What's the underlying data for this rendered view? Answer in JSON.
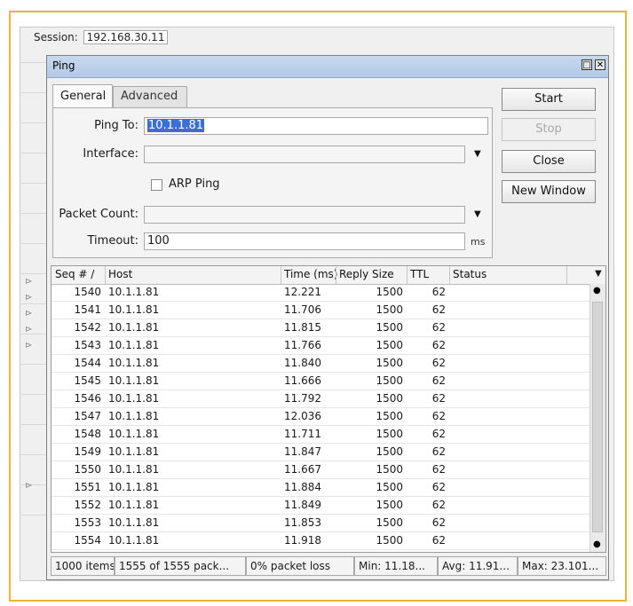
{
  "session": {
    "label": "Session:",
    "value": "192.168.30.11"
  },
  "window": {
    "title": "Ping"
  },
  "tabs": [
    {
      "label": "General"
    },
    {
      "label": "Advanced"
    }
  ],
  "form": {
    "ping_to_label": "Ping To:",
    "ping_to_value": "10.1.1.81",
    "interface_label": "Interface:",
    "interface_value": "",
    "arp_ping_label": "ARP Ping",
    "arp_ping_checked": false,
    "packet_count_label": "Packet Count:",
    "packet_count_value": "",
    "timeout_label": "Timeout:",
    "timeout_value": "100",
    "timeout_unit": "ms"
  },
  "buttons": {
    "start": "Start",
    "stop": "Stop",
    "close": "Close",
    "new_window": "New Window"
  },
  "table": {
    "columns": [
      "Seq # /",
      "Host",
      "Time (ms)",
      "Reply Size",
      "TTL",
      "Status"
    ],
    "rows": [
      {
        "seq": "1540",
        "host": "10.1.1.81",
        "time": "12.221",
        "size": "1500",
        "ttl": "62",
        "status": ""
      },
      {
        "seq": "1541",
        "host": "10.1.1.81",
        "time": "11.706",
        "size": "1500",
        "ttl": "62",
        "status": ""
      },
      {
        "seq": "1542",
        "host": "10.1.1.81",
        "time": "11.815",
        "size": "1500",
        "ttl": "62",
        "status": ""
      },
      {
        "seq": "1543",
        "host": "10.1.1.81",
        "time": "11.766",
        "size": "1500",
        "ttl": "62",
        "status": ""
      },
      {
        "seq": "1544",
        "host": "10.1.1.81",
        "time": "11.840",
        "size": "1500",
        "ttl": "62",
        "status": ""
      },
      {
        "seq": "1545",
        "host": "10.1.1.81",
        "time": "11.666",
        "size": "1500",
        "ttl": "62",
        "status": ""
      },
      {
        "seq": "1546",
        "host": "10.1.1.81",
        "time": "11.792",
        "size": "1500",
        "ttl": "62",
        "status": ""
      },
      {
        "seq": "1547",
        "host": "10.1.1.81",
        "time": "12.036",
        "size": "1500",
        "ttl": "62",
        "status": ""
      },
      {
        "seq": "1548",
        "host": "10.1.1.81",
        "time": "11.711",
        "size": "1500",
        "ttl": "62",
        "status": ""
      },
      {
        "seq": "1549",
        "host": "10.1.1.81",
        "time": "11.847",
        "size": "1500",
        "ttl": "62",
        "status": ""
      },
      {
        "seq": "1550",
        "host": "10.1.1.81",
        "time": "11.667",
        "size": "1500",
        "ttl": "62",
        "status": ""
      },
      {
        "seq": "1551",
        "host": "10.1.1.81",
        "time": "11.884",
        "size": "1500",
        "ttl": "62",
        "status": ""
      },
      {
        "seq": "1552",
        "host": "10.1.1.81",
        "time": "11.849",
        "size": "1500",
        "ttl": "62",
        "status": ""
      },
      {
        "seq": "1553",
        "host": "10.1.1.81",
        "time": "11.853",
        "size": "1500",
        "ttl": "62",
        "status": ""
      },
      {
        "seq": "1554",
        "host": "10.1.1.81",
        "time": "11.918",
        "size": "1500",
        "ttl": "62",
        "status": ""
      }
    ]
  },
  "statusbar": {
    "items": "1000 items",
    "packets": "1555 of 1555 pack...",
    "loss": "0% packet loss",
    "min": "Min: 11.18...",
    "avg": "Avg: 11.91...",
    "max": "Max: 23.101..."
  },
  "colors": {
    "frame": "#f2b233",
    "selection": "#3a6fd8",
    "titlebar": "#b3c9e8"
  },
  "icons": {
    "window_buttons": [
      "restore-icon",
      "close-icon"
    ],
    "dropdown": "chevron-down-icon"
  }
}
